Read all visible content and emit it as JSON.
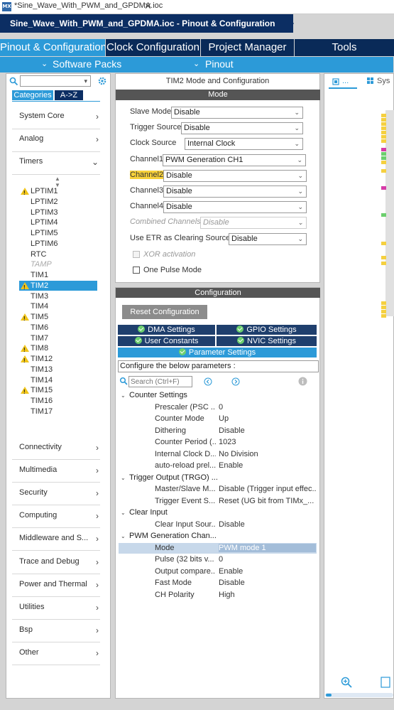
{
  "window": {
    "badge": "MX",
    "tab_title": "*Sine_Wave_With_PWM_and_GPDMA.ioc",
    "close": "✕"
  },
  "breadcrumb": "Sine_Wave_With_PWM_and_GPDMA.ioc - Pinout & Configuration",
  "main_tabs": [
    "Pinout & Configuration",
    "Clock Configuration",
    "Project Manager",
    "Tools"
  ],
  "sub_tabs": {
    "software_packs": "Software Packs",
    "pinout": "Pinout"
  },
  "sidebar": {
    "tabs": {
      "categories": "Categories",
      "az": "A->Z"
    },
    "categories_top": [
      "System Core",
      "Analog",
      "Timers"
    ],
    "timers": [
      {
        "label": "LPTIM1",
        "warn": true,
        "state": "normal"
      },
      {
        "label": "LPTIM2",
        "warn": false,
        "state": "normal"
      },
      {
        "label": "LPTIM3",
        "warn": false,
        "state": "normal"
      },
      {
        "label": "LPTIM4",
        "warn": false,
        "state": "normal"
      },
      {
        "label": "LPTIM5",
        "warn": false,
        "state": "normal"
      },
      {
        "label": "LPTIM6",
        "warn": false,
        "state": "normal"
      },
      {
        "label": "RTC",
        "warn": false,
        "state": "normal"
      },
      {
        "label": "TAMP",
        "warn": false,
        "state": "disabled"
      },
      {
        "label": "TIM1",
        "warn": false,
        "state": "normal"
      },
      {
        "label": "TIM2",
        "warn": true,
        "state": "selected"
      },
      {
        "label": "TIM3",
        "warn": false,
        "state": "normal"
      },
      {
        "label": "TIM4",
        "warn": false,
        "state": "normal"
      },
      {
        "label": "TIM5",
        "warn": true,
        "state": "normal"
      },
      {
        "label": "TIM6",
        "warn": false,
        "state": "normal"
      },
      {
        "label": "TIM7",
        "warn": false,
        "state": "normal"
      },
      {
        "label": "TIM8",
        "warn": true,
        "state": "normal"
      },
      {
        "label": "TIM12",
        "warn": true,
        "state": "normal"
      },
      {
        "label": "TIM13",
        "warn": false,
        "state": "normal"
      },
      {
        "label": "TIM14",
        "warn": false,
        "state": "normal"
      },
      {
        "label": "TIM15",
        "warn": true,
        "state": "normal"
      },
      {
        "label": "TIM16",
        "warn": false,
        "state": "normal"
      },
      {
        "label": "TIM17",
        "warn": false,
        "state": "normal"
      }
    ],
    "categories_bottom": [
      "Connectivity",
      "Multimedia",
      "Security",
      "Computing",
      "Middleware and S...",
      "Trace and Debug",
      "Power and Thermal",
      "Utilities",
      "Bsp",
      "Other"
    ]
  },
  "mode": {
    "title": "TIM2 Mode and Configuration",
    "header": "Mode",
    "fields": [
      {
        "label": "Slave Mode",
        "value": "Disable",
        "highlight": false,
        "disabled": false
      },
      {
        "label": "Trigger Source",
        "value": "Disable",
        "highlight": false,
        "disabled": false
      },
      {
        "label": "Clock Source",
        "value": "Internal Clock",
        "highlight": false,
        "disabled": false
      },
      {
        "label": "Channel1",
        "value": "PWM Generation CH1",
        "highlight": false,
        "disabled": false
      },
      {
        "label": "Channel2",
        "value": "Disable",
        "highlight": true,
        "disabled": false
      },
      {
        "label": "Channel3",
        "value": "Disable",
        "highlight": false,
        "disabled": false
      },
      {
        "label": "Channel4",
        "value": "Disable",
        "highlight": false,
        "disabled": false
      },
      {
        "label": "Combined Channels",
        "value": "Disable",
        "highlight": false,
        "disabled": true
      },
      {
        "label": "Use ETR as Clearing Source",
        "value": "Disable",
        "highlight": false,
        "disabled": false
      }
    ],
    "xor_label": "XOR activation",
    "one_pulse_label": "One Pulse Mode"
  },
  "config": {
    "header": "Configuration",
    "reset_button": "Reset Configuration",
    "tabs": [
      "DMA Settings",
      "GPIO Settings",
      "User Constants",
      "NVIC Settings",
      "Parameter Settings"
    ],
    "hint": "Configure the below parameters :",
    "search_placeholder": "Search (Ctrl+F)",
    "groups": [
      {
        "name": "Counter Settings",
        "params": [
          [
            "Prescaler (PSC ...",
            "0"
          ],
          [
            "Counter Mode",
            "Up"
          ],
          [
            "Dithering",
            "Disable"
          ],
          [
            "Counter Period (...",
            "1023"
          ],
          [
            "Internal Clock D...",
            "No Division"
          ],
          [
            "auto-reload prel...",
            "Enable"
          ]
        ]
      },
      {
        "name": "Trigger Output (TRGO) ...",
        "params": [
          [
            "Master/Slave M...",
            "Disable (Trigger input effec..."
          ],
          [
            "Trigger Event S...",
            "Reset (UG bit from TIMx_..."
          ]
        ]
      },
      {
        "name": "Clear Input",
        "params": [
          [
            "Clear Input Sour...",
            "Disable"
          ]
        ]
      },
      {
        "name": "PWM Generation Chan...",
        "params": [
          [
            "Mode",
            "PWM mode 1"
          ],
          [
            "Pulse (32 bits v...",
            "0"
          ],
          [
            "Output compare...",
            "Enable"
          ],
          [
            "Fast Mode",
            "Disable"
          ],
          [
            "CH Polarity",
            "High"
          ]
        ]
      }
    ]
  },
  "right_panel": {
    "tab2": "Sys",
    "tab1": "..."
  }
}
